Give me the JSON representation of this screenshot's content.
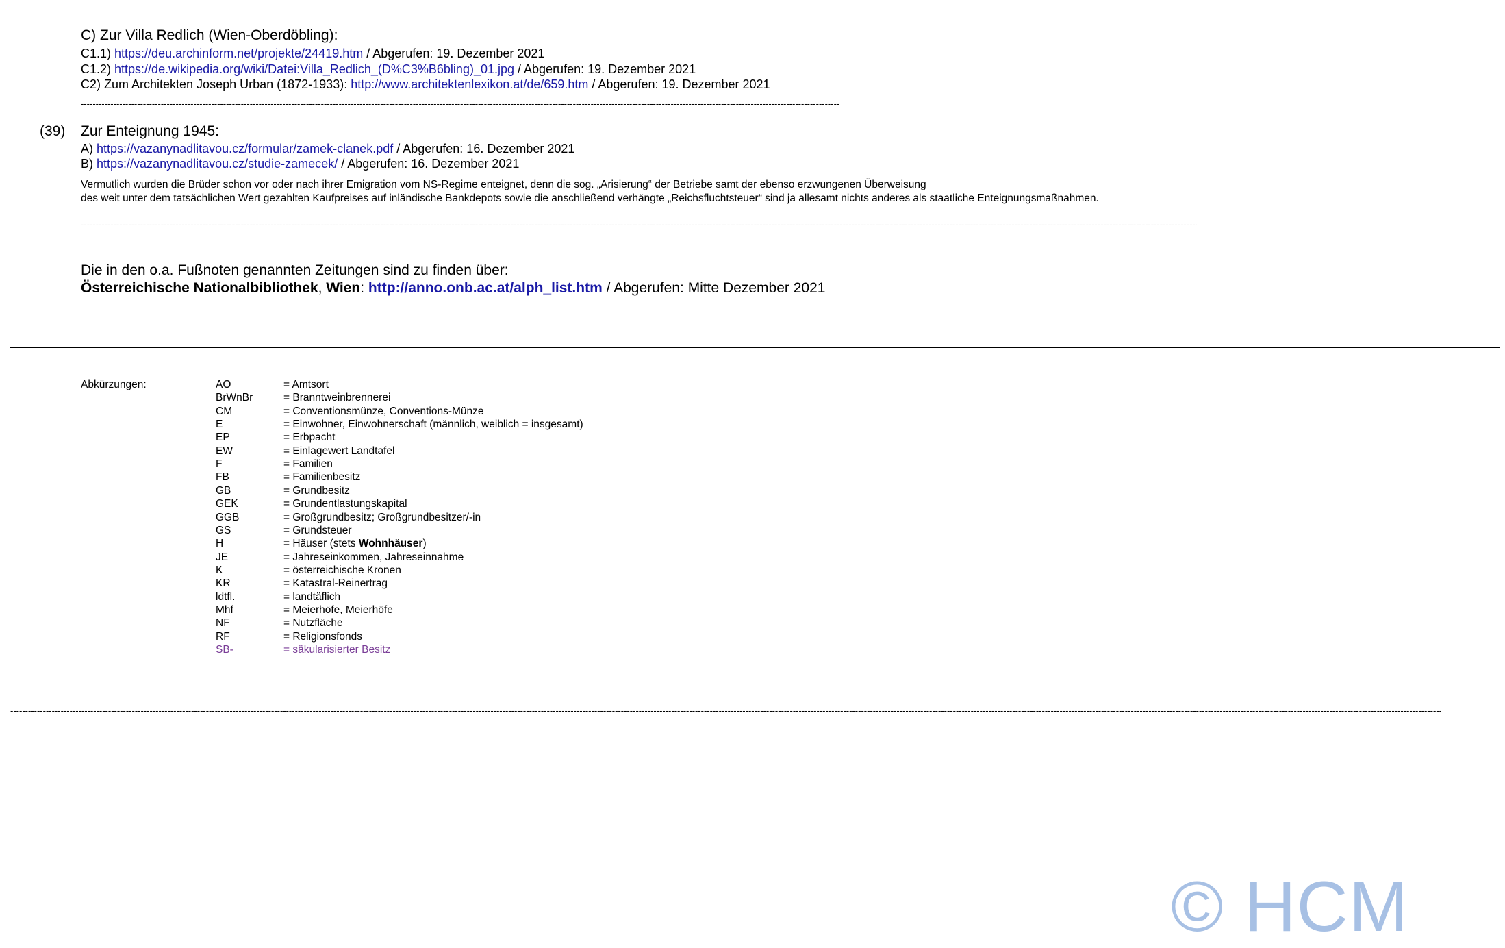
{
  "section_c": {
    "title": "C) Zur Villa Redlich (Wien-Oberdöbling):",
    "items": [
      {
        "prefix": "C1.1) ",
        "link": "https://deu.archinform.net/projekte/24419.htm",
        "suffix": " / Abgerufen: 19. Dezember 2021"
      },
      {
        "prefix": "C1.2) ",
        "link": "https://de.wikipedia.org/wiki/Datei:Villa_Redlich_(D%C3%B6bling)_01.jpg",
        "suffix": " / Abgerufen: 19. Dezember 2021"
      },
      {
        "prefix": "C2) Zum Architekten Joseph Urban (1872-1933): ",
        "link": "http://www.architektenlexikon.at/de/659.htm",
        "suffix": " / Abgerufen: 19. Dezember 2021"
      }
    ]
  },
  "footnote_39": {
    "number": "(39)",
    "title": "Zur Enteignung 1945:",
    "items": [
      {
        "prefix": "A) ",
        "link": "https://vazanynadlitavou.cz/formular/zamek-clanek.pdf",
        "suffix": " / Abgerufen: 16. Dezember 2021"
      },
      {
        "prefix": "B) ",
        "link": "https://vazanynadlitavou.cz/studie-zamecek/",
        "suffix": " / Abgerufen: 16. Dezember 2021"
      }
    ],
    "note_line1": "Vermutlich wurden die Brüder schon vor oder nach ihrer Emigration vom NS-Regime enteignet, denn die sog. „Arisierung“ der Betriebe samt der ebenso erzwungenen Überweisung",
    "note_line2": "des weit unter dem tatsächlichen Wert gezahlten Kaufpreises auf inländische Bankdepots sowie die anschließend verhängte „Reichsfluchtsteuer“ sind ja allesamt nichts anderes als staatliche Enteignungsmaßnahmen."
  },
  "newspapers": {
    "intro": "Die in den o.a. Fußnoten genannten Zeitungen sind zu finden über:",
    "institution": "Österreichische Nationalbibliothek",
    "comma": ", ",
    "city": "Wien",
    "colon": ": ",
    "link": "http://anno.onb.ac.at/alph_list.htm",
    "suffix": " / Abgerufen: Mitte Dezember 2021"
  },
  "abbreviations": {
    "label": "Abkürzungen:",
    "entries": [
      {
        "code": "AO",
        "desc": "= Amtsort"
      },
      {
        "code": "BrWnBr",
        "desc": "= Branntweinbrennerei"
      },
      {
        "code": "CM",
        "desc": "= Conventionsmünze, Conventions-Münze"
      },
      {
        "code": "E",
        "desc": "= Einwohner, Einwohnerschaft (männlich, weiblich = insgesamt)"
      },
      {
        "code": "EP",
        "desc": "= Erbpacht"
      },
      {
        "code": "EW",
        "desc": "= Einlagewert Landtafel"
      },
      {
        "code": "F",
        "desc": "= Familien"
      },
      {
        "code": "FB",
        "desc": "= Familienbesitz"
      },
      {
        "code": "GB",
        "desc": "= Grundbesitz"
      },
      {
        "code": "GEK",
        "desc": "= Grundentlastungskapital"
      },
      {
        "code": "GGB",
        "desc": "= Großgrundbesitz; Großgrundbesitzer/-in"
      },
      {
        "code": "GS",
        "desc": "= Grundsteuer"
      },
      {
        "code": "H",
        "desc": "= Häuser (stets ",
        "desc_bold": "Wohnhäuser",
        "desc_after": ")"
      },
      {
        "code": "JE",
        "desc": "= Jahreseinkommen, Jahreseinnahme"
      },
      {
        "code": "K",
        "desc": "= österreichische Kronen"
      },
      {
        "code": "KR",
        "desc": "= Katastral-Reinertrag"
      },
      {
        "code": "ldtfl.",
        "desc": "= landtäflich"
      },
      {
        "code": "Mhf",
        "desc": "= Meierhöfe, Meierhöfe"
      },
      {
        "code": "NF",
        "desc": "= Nutzfläche"
      },
      {
        "code": "RF",
        "desc": "= Religionsfonds"
      },
      {
        "code": "SB-",
        "desc": "= säkularisierter Besitz",
        "visited": true
      }
    ]
  },
  "watermark": "© HCM",
  "colors": {
    "link": "#1a1aa6",
    "visited": "#7b3f98",
    "watermark": "#a7c0e4"
  }
}
